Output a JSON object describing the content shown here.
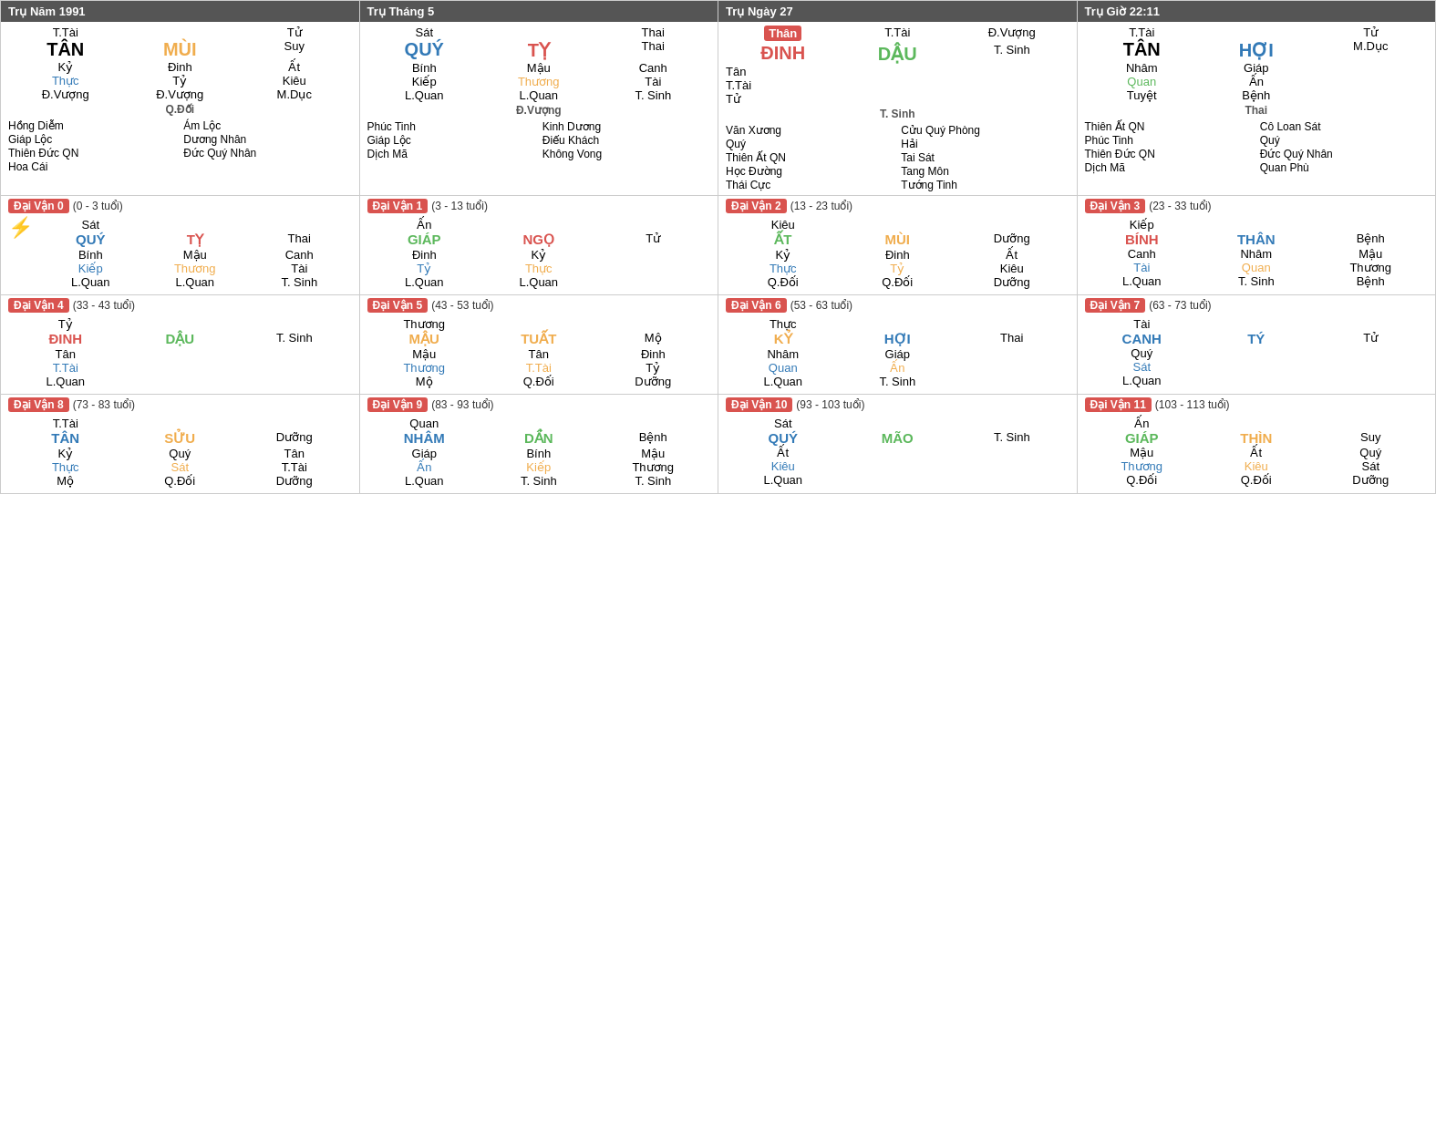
{
  "tru": [
    {
      "title": "Trụ Năm 1991",
      "header_color": "dark",
      "top": {
        "left_top": "T.Tài",
        "center_top": "",
        "right_top": "Tử",
        "left_big": "TÂN",
        "center_big": "MÙI",
        "right_big": "Suy",
        "left_big_color": "black",
        "center_big_color": "orange",
        "right_big_color": "black",
        "left2": "Kỷ",
        "center2": "Đinh",
        "right2": "Ất",
        "left3": "Thực",
        "center3": "Tỷ",
        "right3": "Kiêu",
        "left3_color": "blue",
        "center3_color": "black",
        "right3_color": "black",
        "left4": "Đ.Vượng",
        "center4": "Đ.Vượng",
        "right4": "M.Dục"
      },
      "mid_label": "Q.Đối",
      "stars": [
        "Hồng Diễm",
        "Ám Lộc",
        "Giáp Lộc",
        "Dương Nhân",
        "Thiên Đức QN",
        "Đức Quý Nhân",
        "Hoa Cái"
      ]
    },
    {
      "title": "Trụ Tháng 5",
      "header_color": "dark",
      "top": {
        "left_top": "Sát",
        "center_top": "",
        "right_top": "Thai",
        "left_big": "QUÝ",
        "center_big": "TỴ",
        "right_big": "Thai",
        "left_big_color": "blue",
        "center_big_color": "red",
        "right_big_color": "black",
        "left2": "Bính",
        "center2": "Mậu",
        "right2": "Canh",
        "left3": "Kiếp",
        "center3": "Thương",
        "right3": "Tài",
        "left3_color": "black",
        "center3_color": "orange",
        "right3_color": "black",
        "left4": "L.Quan",
        "center4": "L.Quan",
        "right4": "T. Sinh"
      },
      "mid_label": "Đ.Vượng",
      "stars": [
        "Phúc Tinh",
        "Kinh Dương",
        "Giáp Lộc",
        "Điếu Khách",
        "Dịch Mã",
        "Không Vong"
      ]
    },
    {
      "title": "Trụ Ngày 27",
      "header_color": "dark",
      "special": true,
      "top": {
        "highlight_left": "Thân",
        "highlight_left_color": "red",
        "left_big": "ĐINH",
        "center_big": "DẬU",
        "left_big_color": "red",
        "center_big_color": "green",
        "right_top2": "Đ.Vượng",
        "right_mid2": "T. Sinh",
        "left2": "Tân",
        "left3": "T.Tài",
        "left3_color": "black",
        "left4": "Tử",
        "left_label": "T.Tài"
      },
      "mid_label": "T. Sinh",
      "stars": [
        "Văn Xương",
        "Cửu Quý Phòng",
        "Quý",
        "Hải",
        "Thiên Ất QN",
        "Tai Sát",
        "Học Đường",
        "Tang Môn",
        "Thái Cực",
        "Tướng Tinh"
      ]
    },
    {
      "title": "Trụ Giờ 22:11",
      "header_color": "dark",
      "top": {
        "left_top": "T.Tài",
        "right_top": "Tử",
        "left_big": "TÂN",
        "center_big": "HỢI",
        "right_big": "M.Dục",
        "left_big_color": "black",
        "center_big_color": "blue",
        "right_big_color": "black",
        "left2": "Nhâm",
        "center2": "Giáp",
        "left3": "Quan",
        "center3": "Ấn",
        "left3_color": "green",
        "center3_color": "black",
        "left4": "Tuyệt",
        "center4": "Bệnh"
      },
      "mid_label": "Thai",
      "stars": [
        "Thiên Ất QN",
        "Cô Loan Sát",
        "Phúc Tinh",
        "Quý",
        "Thiên Đức QN",
        "Đức Quý Nhân",
        "Dịch Mã",
        "Quan Phù"
      ]
    }
  ],
  "dai_van": [
    {
      "label": "Đại Vận 0",
      "age": "(0 - 3 tuổi)",
      "top1": "Sát",
      "left_big": "QUÝ",
      "center_big": "TỴ",
      "right_top": "Thai",
      "left_big_color": "blue",
      "center_big_color": "red",
      "left2": "Bính",
      "center2": "Mậu",
      "right2": "Canh",
      "left3": "Kiếp",
      "center3": "Thương",
      "right3": "Tài",
      "left4": "L.Quan",
      "center4": "L.Quan",
      "right4": "T. Sinh",
      "lightning": true
    },
    {
      "label": "Đại Vận 1",
      "age": "(3 - 13 tuổi)",
      "top1": "Ấn",
      "left_big": "GIÁP",
      "center_big": "NGỌ",
      "right_top": "Tử",
      "left_big_color": "green",
      "center_big_color": "red",
      "left2": "Đinh",
      "center2": "Kỷ",
      "left3": "Tỷ",
      "center3": "Thực",
      "left4": "L.Quan",
      "center4": "L.Quan"
    },
    {
      "label": "Đại Vận 2",
      "age": "(13 - 23 tuổi)",
      "top1": "Kiêu",
      "left_big": "ẤT",
      "center_big": "MÙI",
      "right_top": "Dưỡng",
      "left_big_color": "green",
      "center_big_color": "orange",
      "left2": "Kỷ",
      "center2": "Đinh",
      "right2": "Ất",
      "left3": "Thực",
      "center3": "Tỷ",
      "right3": "Kiêu",
      "left4": "Q.Đối",
      "center4": "Q.Đối",
      "right4": "Dưỡng"
    },
    {
      "label": "Đại Vận 3",
      "age": "(23 - 33 tuổi)",
      "top1": "Kiếp",
      "left_big": "BÍNH",
      "center_big": "THÂN",
      "right_top": "Bệnh",
      "left_big_color": "red",
      "center_big_color": "blue",
      "left2": "Canh",
      "center2": "Nhâm",
      "right2": "Mậu",
      "left3": "Tài",
      "center3": "Quan",
      "right3": "Thương",
      "left4": "L.Quan",
      "center4": "T. Sinh",
      "right4": "Bệnh"
    },
    {
      "label": "Đại Vận 4",
      "age": "(33 - 43 tuổi)",
      "top1": "Tỷ",
      "left_big": "ĐINH",
      "center_big": "DẬU",
      "right_top": "T. Sinh",
      "left_big_color": "red",
      "center_big_color": "green",
      "left2": "Tân",
      "left3": "T.Tài",
      "left4": "L.Quan"
    },
    {
      "label": "Đại Vận 5",
      "age": "(43 - 53 tuổi)",
      "top1": "Thương",
      "left_big": "MẬU",
      "center_big": "TUẤT",
      "right_top": "Mộ",
      "left_big_color": "orange",
      "center_big_color": "orange",
      "left2": "Mậu",
      "center2": "Tân",
      "right2": "Đinh",
      "left3": "Thương",
      "center3": "T.Tài",
      "right3": "Tỷ",
      "left4": "Mộ",
      "center4": "Q.Đối",
      "right4": "Dưỡng"
    },
    {
      "label": "Đại Vận 6",
      "age": "(53 - 63 tuổi)",
      "top1": "Thực",
      "left_big": "KỶ",
      "center_big": "HỢI",
      "right_top": "Thai",
      "left_big_color": "orange",
      "center_big_color": "blue",
      "left2": "Nhâm",
      "center2": "Giáp",
      "left3": "Quan",
      "center3": "Ấn",
      "left4": "L.Quan",
      "center4": "T. Sinh"
    },
    {
      "label": "Đại Vận 7",
      "age": "(63 - 73 tuổi)",
      "top1": "Tài",
      "left_big": "CANH",
      "center_big": "TÝ",
      "right_top": "Tử",
      "left_big_color": "blue",
      "center_big_color": "blue",
      "left2": "Quý",
      "left3": "Sát",
      "left4": "L.Quan"
    },
    {
      "label": "Đại Vận 8",
      "age": "(73 - 83 tuổi)",
      "top1": "T.Tài",
      "left_big": "TÂN",
      "center_big": "SỬU",
      "right_top": "Dưỡng",
      "left_big_color": "blue",
      "center_big_color": "orange",
      "left2": "Kỷ",
      "center2": "Quý",
      "right2": "Tân",
      "left3": "Thực",
      "center3": "Sát",
      "right3": "T.Tài",
      "left4": "Mộ",
      "center4": "Q.Đối",
      "right4": "Dưỡng"
    },
    {
      "label": "Đại Vận 9",
      "age": "(83 - 93 tuổi)",
      "top1": "Quan",
      "left_big": "NHÂM",
      "center_big": "DẦN",
      "right_top": "Bệnh",
      "left_big_color": "blue",
      "center_big_color": "green",
      "left2": "Giáp",
      "center2": "Bính",
      "right2": "Mậu",
      "left3": "Ấn",
      "center3": "Kiếp",
      "right3": "Thương",
      "left4": "L.Quan",
      "center4": "T. Sinh",
      "right4": "T. Sinh"
    },
    {
      "label": "Đại Vận 10",
      "age": "(93 - 103 tuổi)",
      "top1": "Sát",
      "left_big": "QUÝ",
      "center_big": "MÃO",
      "right_top": "T. Sinh",
      "left_big_color": "blue",
      "center_big_color": "green",
      "left2": "Ất",
      "left3": "Kiêu",
      "left4": "L.Quan"
    },
    {
      "label": "Đại Vận 11",
      "age": "(103 - 113 tuổi)",
      "top1": "Ấn",
      "left_big": "GIÁP",
      "center_big": "THÌN",
      "right_top": "Suy",
      "left_big_color": "green",
      "center_big_color": "orange",
      "left2": "Mậu",
      "center2": "Ất",
      "right2": "Quý",
      "left3": "Thương",
      "center3": "Kiêu",
      "right3": "Sát",
      "left4": "Q.Đối",
      "center4": "Q.Đối",
      "right4": "Dưỡng"
    }
  ]
}
